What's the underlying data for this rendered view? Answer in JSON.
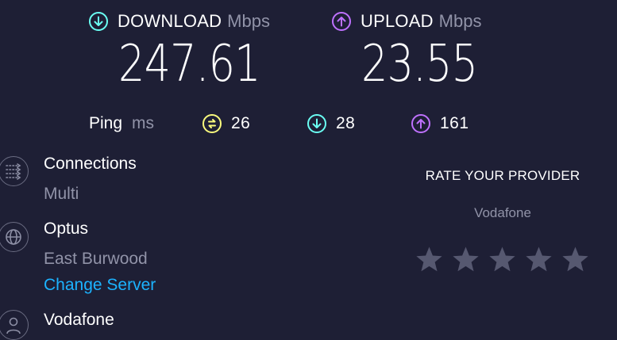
{
  "download": {
    "title": "DOWNLOAD",
    "unit": "Mbps",
    "value": "247.61",
    "icon": "arrow-down-circle-icon",
    "color": "#6afff3"
  },
  "upload": {
    "title": "UPLOAD",
    "unit": "Mbps",
    "value": "23.55",
    "icon": "arrow-up-circle-icon",
    "color": "#bf71ff"
  },
  "ping": {
    "label": "Ping",
    "unit": "ms",
    "idle": {
      "value": "26",
      "icon": "ping-idle-icon",
      "color": "#fbfb7d"
    },
    "download": {
      "value": "28",
      "icon": "ping-download-icon",
      "color": "#6afff3"
    },
    "upload": {
      "value": "161",
      "icon": "ping-upload-icon",
      "color": "#bf71ff"
    }
  },
  "connections": {
    "title": "Connections",
    "value": "Multi",
    "icon": "connections-icon"
  },
  "server": {
    "name": "Optus",
    "location": "East Burwood",
    "change_label": "Change Server",
    "icon": "globe-icon"
  },
  "isp": {
    "name": "Vodafone",
    "icon": "user-icon"
  },
  "rating": {
    "title": "RATE YOUR PROVIDER",
    "provider": "Vodafone",
    "stars": 5,
    "star_color": "#565870"
  },
  "colors": {
    "background": "#1e1f35",
    "secondary_text": "#9193a8",
    "link": "#1cb3ff"
  }
}
